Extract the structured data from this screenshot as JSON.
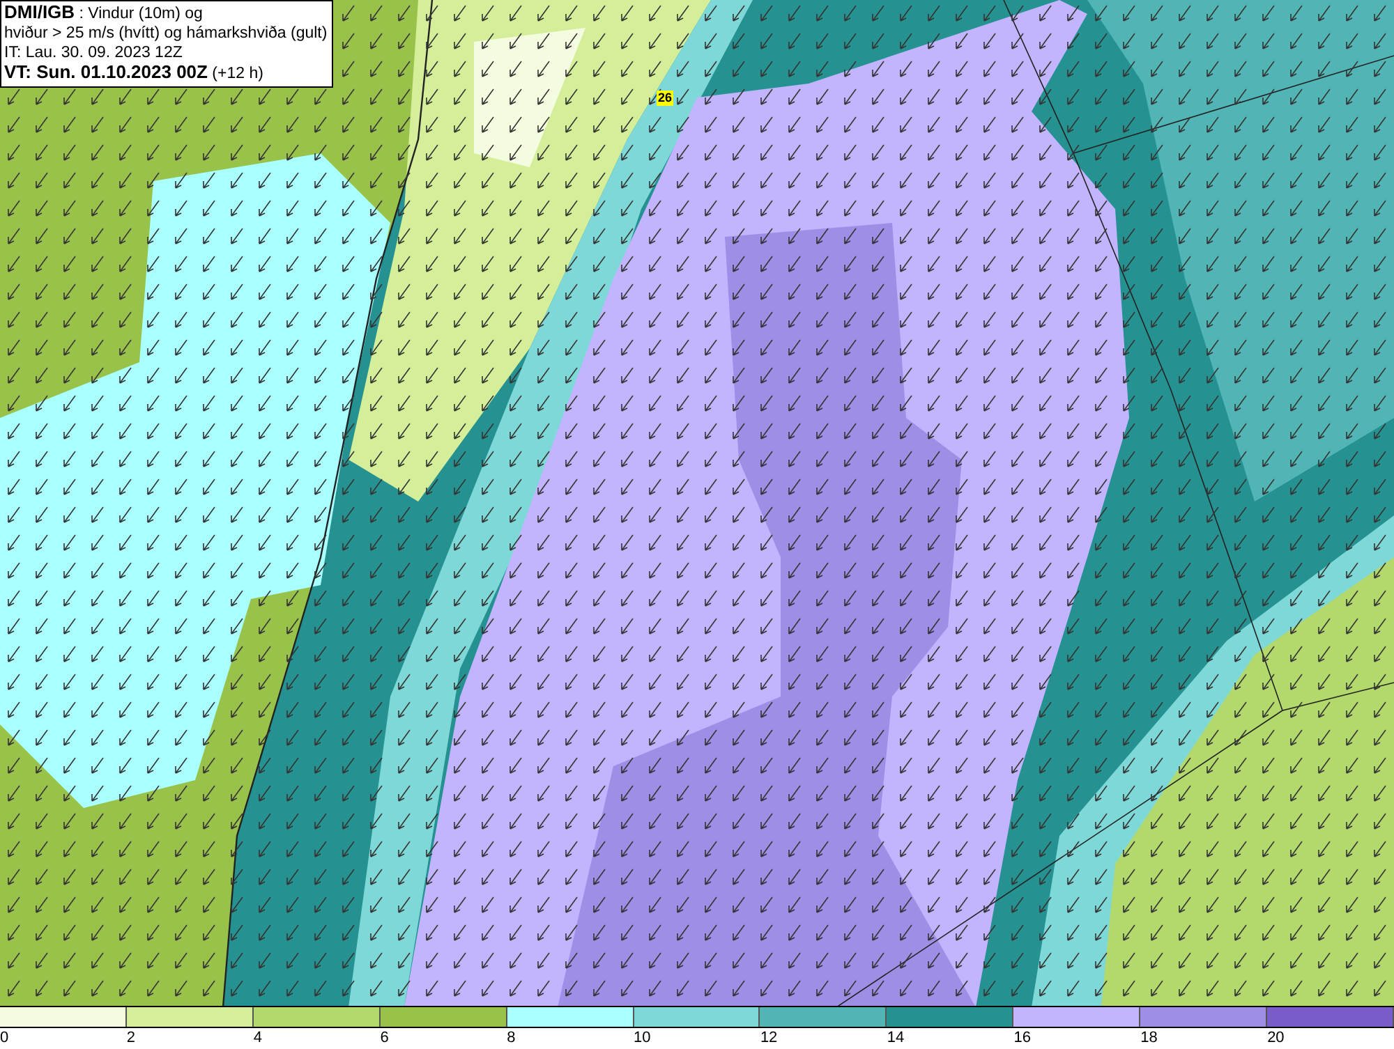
{
  "title_box": {
    "lines": [
      "**DMI/IGB** : Vindur (10m) og",
      "hviður > 25 m/s (hvítt) og hámarkshviða (gult)",
      "IT: Lau. 30. 09. 2023 12Z",
      "**VT: Sun. 01.10.2023 00Z** (+12 h)"
    ]
  },
  "map": {
    "gust_labels": [
      "26"
    ]
  },
  "legend": {
    "bins": [
      {
        "color": "#f5fde0"
      },
      {
        "color": "#d4ee9a"
      },
      {
        "color": "#b3d96c"
      },
      {
        "color": "#99c24a"
      },
      {
        "color": "#aaffff"
      },
      {
        "color": "#7fd8d8"
      },
      {
        "color": "#52b5b5"
      },
      {
        "color": "#259191"
      },
      {
        "color": "#c3b4ff"
      },
      {
        "color": "#9f8ee6"
      },
      {
        "color": "#7a5cc8"
      }
    ],
    "ticks": [
      "0",
      "2",
      "4",
      "6",
      "8",
      "10",
      "12",
      "14",
      "16",
      "18",
      "20"
    ]
  }
}
